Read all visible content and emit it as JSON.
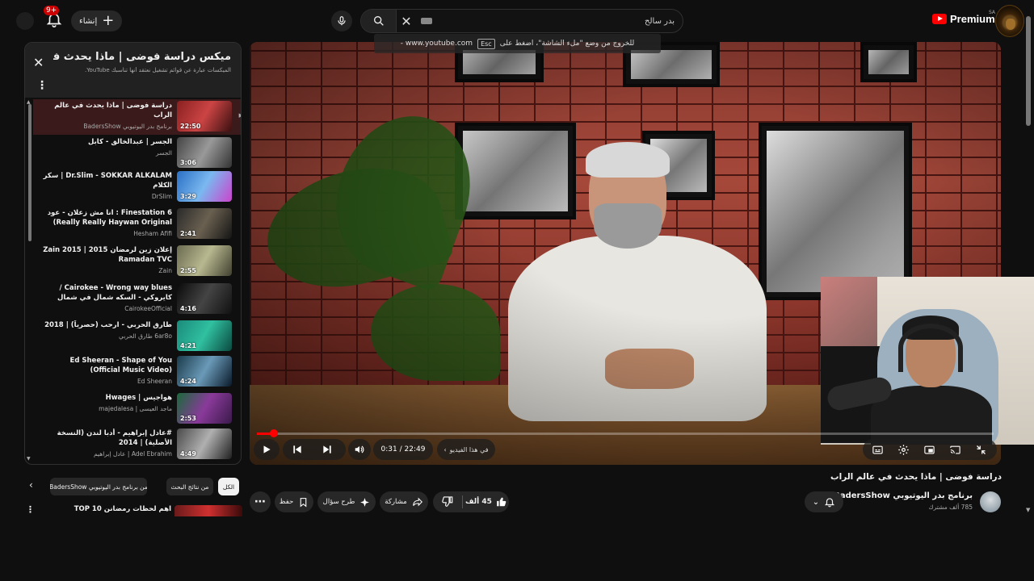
{
  "topbar": {
    "notification_count": "9+",
    "create_label": "إنشاء",
    "search_query": "بدر سالح",
    "logo_text": "Premium",
    "logo_country": "SA"
  },
  "playlist": {
    "title": "ميكس دراسة فوضى | ماذا يحدث فـ...",
    "subtitle": "الميكسات عبارة عن قوائم تشغيل نعتقد أنها تناسبك YouTube.",
    "items": [
      {
        "title": "دراسة فوضى | ماذا يحدث في عالم الراب",
        "channel": "برنامج بدر اليوتيوبي BadersShow",
        "duration": "22:50",
        "active": true
      },
      {
        "title": "الجسر | عبدالخالق - كابل",
        "channel": "الجسر",
        "duration": "3:06"
      },
      {
        "title": "Dr.Slim - SOKKAR ALKALAM | سكر الكلام",
        "channel": "DrSlim",
        "duration": "3:29"
      },
      {
        "title": "Finestation 6 : انا مش زعلان - عود Really Really Haywan Original)",
        "channel": "Hesham Afifi",
        "duration": "2:41"
      },
      {
        "title": "إعلان زين لرمضان 2015 | Zain 2015 Ramadan TVC",
        "channel": "Zain",
        "duration": "2:55"
      },
      {
        "title": "Cairokee - Wrong way blues / كايروكي - السكه شمال في شمال",
        "channel": "CairokeeOfficial",
        "duration": "4:16"
      },
      {
        "title": "طارق الحربي - ارحب (حصرياً) | 2018",
        "channel": "6ar8o طارق الحربي",
        "duration": "4:21"
      },
      {
        "title": "Ed Sheeran - Shape of You (Official Music Video)",
        "channel": "Ed Sheeran",
        "duration": "4:24"
      },
      {
        "title": "هواجيس | Hwages",
        "channel": "ماجد العيسى | majedalesa",
        "duration": "2:53"
      },
      {
        "title": "#عادل إبراهيم - أدبا لندن (النسخة الأصلية) | 2014",
        "channel": "Adel Ebrahim | عادل إبراهيم",
        "duration": "4:49"
      }
    ]
  },
  "player": {
    "esc_hint": "للخروج من وضع \"ملء الشاشة\"، اضغط على",
    "esc_key": "Esc",
    "esc_domain": "www.youtube.com -",
    "current_time": "0:31",
    "total_time": "22:49",
    "time_display": "0:31 / 22:49",
    "progress_fraction": 0.023,
    "chapter_label": "في هذا الفيديو"
  },
  "video": {
    "title": "دراسة فوضى | ماذا يحدث في عالم الراب",
    "channel_name": "برنامج بدر اليوتيوبي BadersShow",
    "subscribers": "785 ألف مشترك",
    "likes": "45 ألف",
    "share_label": "مشاركة",
    "ask_label": "طرح سؤال",
    "save_label": "حفظ"
  },
  "chips": {
    "all": "الكل",
    "search_results": "من نتائج البحث",
    "from_channel": "من برنامج بدر اليوتيوبي BadersShow"
  },
  "recommendation": {
    "title": "اهم لحظات رمضانن TOP 10"
  }
}
